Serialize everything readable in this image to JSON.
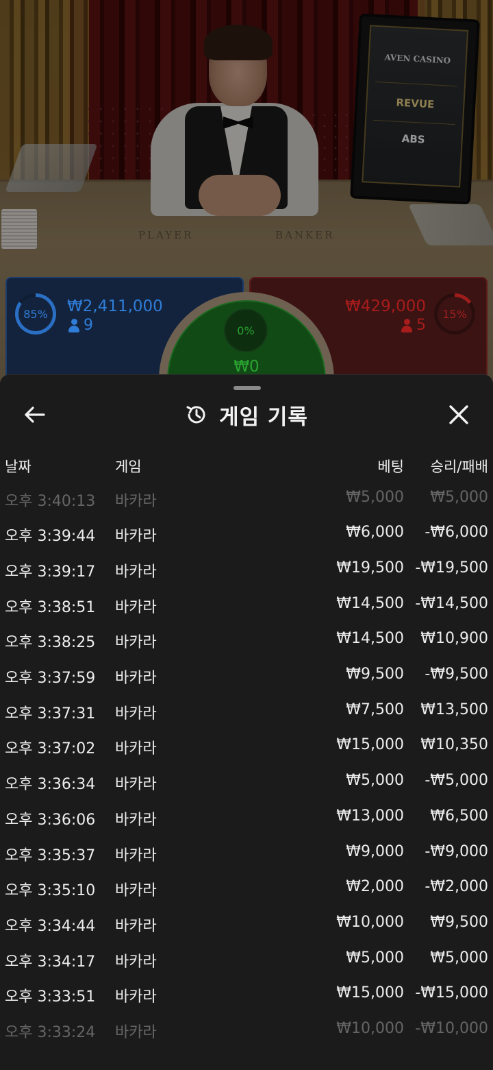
{
  "stream": {
    "table_labels": {
      "player": "PLAYER",
      "banker": "BANKER"
    },
    "sponsors": [
      "AVEN CASINO",
      "REVUE",
      "ABS"
    ]
  },
  "bets": {
    "player": {
      "percent": "85%",
      "amount": "₩2,411,000",
      "players": "9",
      "color": "#2f7dd8"
    },
    "banker": {
      "percent": "15%",
      "amount": "₩429,000",
      "players": "5",
      "color": "#a81c1c"
    },
    "tie": {
      "percent": "0%",
      "amount": "₩0",
      "color": "#2aa331"
    }
  },
  "history": {
    "title": "게임 기록",
    "icons": {
      "back": "arrow-left-icon",
      "history": "history-icon",
      "close": "close-icon"
    },
    "columns": {
      "date": "날짜",
      "game": "게임",
      "bet": "베팅",
      "win_loss": "승리/패배"
    },
    "rows": [
      {
        "time": "오후 3:40:13",
        "game": "바카라",
        "bet": "₩5,000",
        "result": "₩5,000"
      },
      {
        "time": "오후 3:39:44",
        "game": "바카라",
        "bet": "₩6,000",
        "result": "-₩6,000"
      },
      {
        "time": "오후 3:39:17",
        "game": "바카라",
        "bet": "₩19,500",
        "result": "-₩19,500"
      },
      {
        "time": "오후 3:38:51",
        "game": "바카라",
        "bet": "₩14,500",
        "result": "-₩14,500"
      },
      {
        "time": "오후 3:38:25",
        "game": "바카라",
        "bet": "₩14,500",
        "result": "₩10,900"
      },
      {
        "time": "오후 3:37:59",
        "game": "바카라",
        "bet": "₩9,500",
        "result": "-₩9,500"
      },
      {
        "time": "오후 3:37:31",
        "game": "바카라",
        "bet": "₩7,500",
        "result": "₩13,500"
      },
      {
        "time": "오후 3:37:02",
        "game": "바카라",
        "bet": "₩15,000",
        "result": "₩10,350"
      },
      {
        "time": "오후 3:36:34",
        "game": "바카라",
        "bet": "₩5,000",
        "result": "-₩5,000"
      },
      {
        "time": "오후 3:36:06",
        "game": "바카라",
        "bet": "₩13,000",
        "result": "₩6,500"
      },
      {
        "time": "오후 3:35:37",
        "game": "바카라",
        "bet": "₩9,000",
        "result": "-₩9,000"
      },
      {
        "time": "오후 3:35:10",
        "game": "바카라",
        "bet": "₩2,000",
        "result": "-₩2,000"
      },
      {
        "time": "오후 3:34:44",
        "game": "바카라",
        "bet": "₩10,000",
        "result": "₩9,500"
      },
      {
        "time": "오후 3:34:17",
        "game": "바카라",
        "bet": "₩5,000",
        "result": "₩5,000"
      },
      {
        "time": "오후 3:33:51",
        "game": "바카라",
        "bet": "₩15,000",
        "result": "-₩15,000"
      },
      {
        "time": "오후 3:33:24",
        "game": "바카라",
        "bet": "₩10,000",
        "result": "-₩10,000"
      }
    ]
  }
}
